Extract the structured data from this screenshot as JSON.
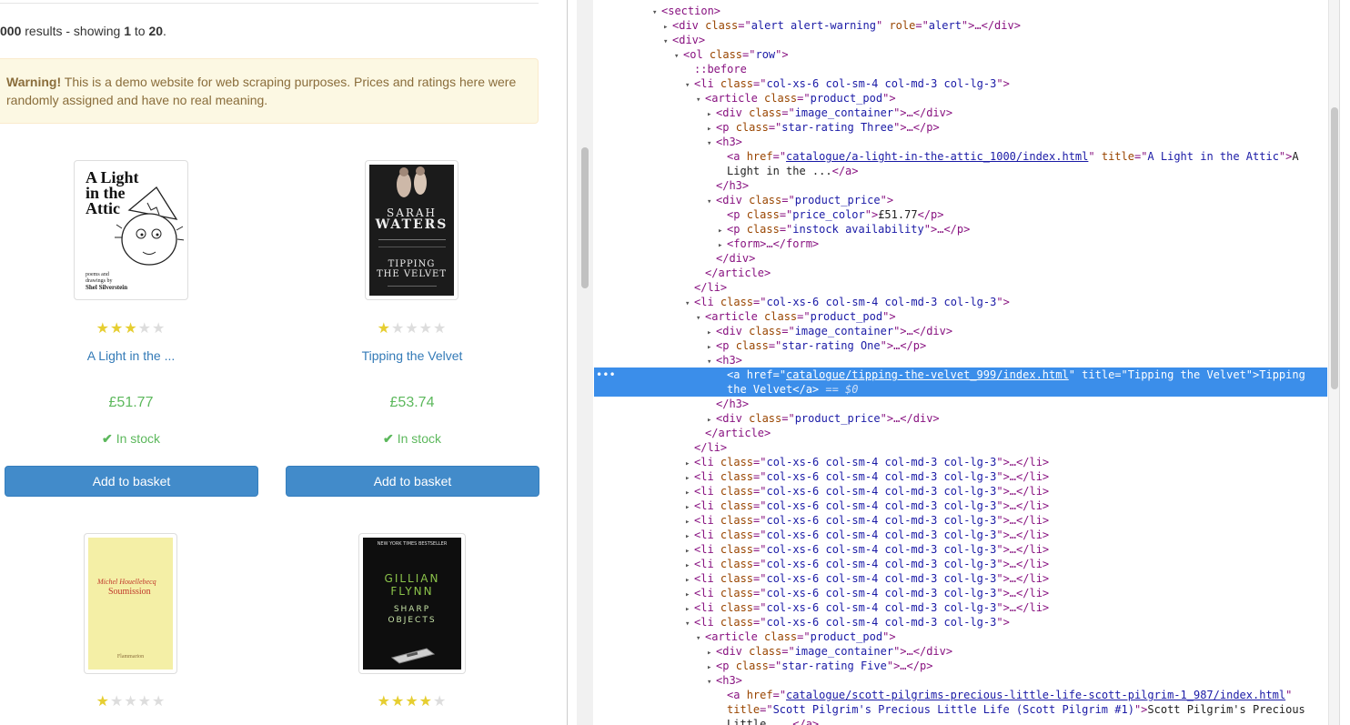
{
  "results": {
    "count": "000",
    "text1": " results - showing ",
    "from": "1",
    "text2": " to ",
    "to": "20",
    "text3": "."
  },
  "alert": {
    "strong": "Warning!",
    "text": " This is a demo website for web scraping purposes. Prices and ratings here were randomly assigned and have no real meaning."
  },
  "products": [
    {
      "title": "A Light in the ...",
      "rating": 3,
      "price": "£51.77",
      "stock": "In stock",
      "button": "Add to basket",
      "cover": {
        "line1": "A Light",
        "line2": "in the",
        "line3": "Attic",
        "byline1": "poems and",
        "byline2": "drawings by",
        "author": "Shel Silverstein"
      }
    },
    {
      "title": "Tipping the Velvet",
      "rating": 1,
      "price": "£53.74",
      "stock": "In stock",
      "button": "Add to basket",
      "cover": {
        "author1": "SARAH",
        "author2": "WATERS",
        "title1": "TIPPING",
        "title2": "THE VELVET"
      }
    },
    {
      "title": "",
      "rating": 1,
      "cover": {
        "author": "Michel Houellebecq",
        "title": "Soumission",
        "publisher": "Flammarion"
      }
    },
    {
      "title": "",
      "rating": 4,
      "cover": {
        "top": "NEW YORK TIMES BESTSELLER",
        "author1": "GILLIAN",
        "author2": "FLYNN",
        "title1": "SHARP",
        "title2": "OBJECTS"
      }
    }
  ],
  "devtools": {
    "selected_suffix": " == $0",
    "lines": [
      {
        "ind": 6,
        "tri": "▾",
        "parts": [
          [
            "t",
            "<section>"
          ]
        ]
      },
      {
        "ind": 7,
        "tri": "▸",
        "parts": [
          [
            "t",
            "<div "
          ],
          [
            "an",
            "class"
          ],
          [
            "t",
            "=\""
          ],
          [
            "av",
            "alert alert-warning"
          ],
          [
            "t",
            "\" "
          ],
          [
            "an",
            "role"
          ],
          [
            "t",
            "=\""
          ],
          [
            "av",
            "alert"
          ],
          [
            "t",
            "\">…</div>"
          ]
        ]
      },
      {
        "ind": 7,
        "tri": "▾",
        "parts": [
          [
            "t",
            "<div>"
          ]
        ]
      },
      {
        "ind": 8,
        "tri": "▾",
        "parts": [
          [
            "t",
            "<ol "
          ],
          [
            "an",
            "class"
          ],
          [
            "t",
            "=\""
          ],
          [
            "av",
            "row"
          ],
          [
            "t",
            "\">"
          ]
        ]
      },
      {
        "ind": 9,
        "tri": "",
        "parts": [
          [
            "ps",
            "::before"
          ]
        ]
      },
      {
        "ind": 9,
        "tri": "▾",
        "parts": [
          [
            "t",
            "<li "
          ],
          [
            "an",
            "class"
          ],
          [
            "t",
            "=\""
          ],
          [
            "av",
            "col-xs-6 col-sm-4 col-md-3 col-lg-3"
          ],
          [
            "t",
            "\">"
          ]
        ]
      },
      {
        "ind": 10,
        "tri": "▾",
        "parts": [
          [
            "t",
            "<article "
          ],
          [
            "an",
            "class"
          ],
          [
            "t",
            "=\""
          ],
          [
            "av",
            "product_pod"
          ],
          [
            "t",
            "\">"
          ]
        ]
      },
      {
        "ind": 11,
        "tri": "▸",
        "parts": [
          [
            "t",
            "<div "
          ],
          [
            "an",
            "class"
          ],
          [
            "t",
            "=\""
          ],
          [
            "av",
            "image_container"
          ],
          [
            "t",
            "\">…</div>"
          ]
        ]
      },
      {
        "ind": 11,
        "tri": "▸",
        "parts": [
          [
            "t",
            "<p "
          ],
          [
            "an",
            "class"
          ],
          [
            "t",
            "=\""
          ],
          [
            "av",
            "star-rating Three"
          ],
          [
            "t",
            "\">…</p>"
          ]
        ]
      },
      {
        "ind": 11,
        "tri": "▾",
        "parts": [
          [
            "t",
            "<h3>"
          ]
        ]
      },
      {
        "ind": 12,
        "tri": "",
        "parts": [
          [
            "t",
            "<a "
          ],
          [
            "an",
            "href"
          ],
          [
            "t",
            "=\""
          ],
          [
            "lk",
            "catalogue/a-light-in-the-attic_1000/index.html"
          ],
          [
            "t",
            "\" "
          ],
          [
            "an",
            "title"
          ],
          [
            "t",
            "=\""
          ],
          [
            "av",
            "A Light in the Attic"
          ],
          [
            "t",
            "\">"
          ],
          [
            "tx",
            "A"
          ]
        ]
      },
      {
        "ind": 12,
        "tri": "",
        "parts": [
          [
            "tx",
            "Light in the ..."
          ],
          [
            "t",
            "</a>"
          ]
        ]
      },
      {
        "ind": 11,
        "tri": "",
        "parts": [
          [
            "t",
            "</h3>"
          ]
        ]
      },
      {
        "ind": 11,
        "tri": "▾",
        "parts": [
          [
            "t",
            "<div "
          ],
          [
            "an",
            "class"
          ],
          [
            "t",
            "=\""
          ],
          [
            "av",
            "product_price"
          ],
          [
            "t",
            "\">"
          ]
        ]
      },
      {
        "ind": 12,
        "tri": "",
        "parts": [
          [
            "t",
            "<p "
          ],
          [
            "an",
            "class"
          ],
          [
            "t",
            "=\""
          ],
          [
            "av",
            "price_color"
          ],
          [
            "t",
            "\">"
          ],
          [
            "tx",
            "£51.77"
          ],
          [
            "t",
            "</p>"
          ]
        ]
      },
      {
        "ind": 12,
        "tri": "▸",
        "parts": [
          [
            "t",
            "<p "
          ],
          [
            "an",
            "class"
          ],
          [
            "t",
            "=\""
          ],
          [
            "av",
            "instock availability"
          ],
          [
            "t",
            "\">…</p>"
          ]
        ]
      },
      {
        "ind": 12,
        "tri": "▸",
        "parts": [
          [
            "t",
            "<form>…</form>"
          ]
        ]
      },
      {
        "ind": 11,
        "tri": "",
        "parts": [
          [
            "t",
            "</div>"
          ]
        ]
      },
      {
        "ind": 10,
        "tri": "",
        "parts": [
          [
            "t",
            "</article>"
          ]
        ]
      },
      {
        "ind": 9,
        "tri": "",
        "parts": [
          [
            "t",
            "</li>"
          ]
        ]
      },
      {
        "ind": 9,
        "tri": "▾",
        "parts": [
          [
            "t",
            "<li "
          ],
          [
            "an",
            "class"
          ],
          [
            "t",
            "=\""
          ],
          [
            "av",
            "col-xs-6 col-sm-4 col-md-3 col-lg-3"
          ],
          [
            "t",
            "\">"
          ]
        ]
      },
      {
        "ind": 10,
        "tri": "▾",
        "parts": [
          [
            "t",
            "<article "
          ],
          [
            "an",
            "class"
          ],
          [
            "t",
            "=\""
          ],
          [
            "av",
            "product_pod"
          ],
          [
            "t",
            "\">"
          ]
        ]
      },
      {
        "ind": 11,
        "tri": "▸",
        "parts": [
          [
            "t",
            "<div "
          ],
          [
            "an",
            "class"
          ],
          [
            "t",
            "=\""
          ],
          [
            "av",
            "image_container"
          ],
          [
            "t",
            "\">…</div>"
          ]
        ]
      },
      {
        "ind": 11,
        "tri": "▸",
        "parts": [
          [
            "t",
            "<p "
          ],
          [
            "an",
            "class"
          ],
          [
            "t",
            "=\""
          ],
          [
            "av",
            "star-rating One"
          ],
          [
            "t",
            "\">…</p>"
          ]
        ]
      },
      {
        "ind": 11,
        "tri": "▾",
        "parts": [
          [
            "t",
            "<h3>"
          ]
        ]
      },
      {
        "ind": 12,
        "tri": "",
        "selected": true,
        "parts": [
          [
            "t",
            "<a "
          ],
          [
            "an",
            "href"
          ],
          [
            "t",
            "=\""
          ],
          [
            "lk",
            "catalogue/tipping-the-velvet_999/index.html"
          ],
          [
            "t",
            "\" "
          ],
          [
            "an",
            "title"
          ],
          [
            "t",
            "=\""
          ],
          [
            "av",
            "Tipping the Velvet"
          ],
          [
            "t",
            "\">"
          ],
          [
            "tx",
            "Tipping"
          ]
        ],
        "cont": [
          [
            "tx",
            "the Velvet"
          ],
          [
            "t",
            "</a>"
          ]
        ]
      },
      {
        "ind": 11,
        "tri": "",
        "parts": [
          [
            "t",
            "</h3>"
          ]
        ]
      },
      {
        "ind": 11,
        "tri": "▸",
        "parts": [
          [
            "t",
            "<div "
          ],
          [
            "an",
            "class"
          ],
          [
            "t",
            "=\""
          ],
          [
            "av",
            "product_price"
          ],
          [
            "t",
            "\">…</div>"
          ]
        ]
      },
      {
        "ind": 10,
        "tri": "",
        "parts": [
          [
            "t",
            "</article>"
          ]
        ]
      },
      {
        "ind": 9,
        "tri": "",
        "parts": [
          [
            "t",
            "</li>"
          ]
        ]
      },
      {
        "ind": 9,
        "tri": "▸",
        "parts": [
          [
            "t",
            "<li "
          ],
          [
            "an",
            "class"
          ],
          [
            "t",
            "=\""
          ],
          [
            "av",
            "col-xs-6 col-sm-4 col-md-3 col-lg-3"
          ],
          [
            "t",
            "\">…</li>"
          ]
        ]
      },
      {
        "ind": 9,
        "tri": "▸",
        "parts": [
          [
            "t",
            "<li "
          ],
          [
            "an",
            "class"
          ],
          [
            "t",
            "=\""
          ],
          [
            "av",
            "col-xs-6 col-sm-4 col-md-3 col-lg-3"
          ],
          [
            "t",
            "\">…</li>"
          ]
        ]
      },
      {
        "ind": 9,
        "tri": "▸",
        "parts": [
          [
            "t",
            "<li "
          ],
          [
            "an",
            "class"
          ],
          [
            "t",
            "=\""
          ],
          [
            "av",
            "col-xs-6 col-sm-4 col-md-3 col-lg-3"
          ],
          [
            "t",
            "\">…</li>"
          ]
        ]
      },
      {
        "ind": 9,
        "tri": "▸",
        "parts": [
          [
            "t",
            "<li "
          ],
          [
            "an",
            "class"
          ],
          [
            "t",
            "=\""
          ],
          [
            "av",
            "col-xs-6 col-sm-4 col-md-3 col-lg-3"
          ],
          [
            "t",
            "\">…</li>"
          ]
        ]
      },
      {
        "ind": 9,
        "tri": "▸",
        "parts": [
          [
            "t",
            "<li "
          ],
          [
            "an",
            "class"
          ],
          [
            "t",
            "=\""
          ],
          [
            "av",
            "col-xs-6 col-sm-4 col-md-3 col-lg-3"
          ],
          [
            "t",
            "\">…</li>"
          ]
        ]
      },
      {
        "ind": 9,
        "tri": "▸",
        "parts": [
          [
            "t",
            "<li "
          ],
          [
            "an",
            "class"
          ],
          [
            "t",
            "=\""
          ],
          [
            "av",
            "col-xs-6 col-sm-4 col-md-3 col-lg-3"
          ],
          [
            "t",
            "\">…</li>"
          ]
        ]
      },
      {
        "ind": 9,
        "tri": "▸",
        "parts": [
          [
            "t",
            "<li "
          ],
          [
            "an",
            "class"
          ],
          [
            "t",
            "=\""
          ],
          [
            "av",
            "col-xs-6 col-sm-4 col-md-3 col-lg-3"
          ],
          [
            "t",
            "\">…</li>"
          ]
        ]
      },
      {
        "ind": 9,
        "tri": "▸",
        "parts": [
          [
            "t",
            "<li "
          ],
          [
            "an",
            "class"
          ],
          [
            "t",
            "=\""
          ],
          [
            "av",
            "col-xs-6 col-sm-4 col-md-3 col-lg-3"
          ],
          [
            "t",
            "\">…</li>"
          ]
        ]
      },
      {
        "ind": 9,
        "tri": "▸",
        "parts": [
          [
            "t",
            "<li "
          ],
          [
            "an",
            "class"
          ],
          [
            "t",
            "=\""
          ],
          [
            "av",
            "col-xs-6 col-sm-4 col-md-3 col-lg-3"
          ],
          [
            "t",
            "\">…</li>"
          ]
        ]
      },
      {
        "ind": 9,
        "tri": "▸",
        "parts": [
          [
            "t",
            "<li "
          ],
          [
            "an",
            "class"
          ],
          [
            "t",
            "=\""
          ],
          [
            "av",
            "col-xs-6 col-sm-4 col-md-3 col-lg-3"
          ],
          [
            "t",
            "\">…</li>"
          ]
        ]
      },
      {
        "ind": 9,
        "tri": "▸",
        "parts": [
          [
            "t",
            "<li "
          ],
          [
            "an",
            "class"
          ],
          [
            "t",
            "=\""
          ],
          [
            "av",
            "col-xs-6 col-sm-4 col-md-3 col-lg-3"
          ],
          [
            "t",
            "\">…</li>"
          ]
        ]
      },
      {
        "ind": 9,
        "tri": "▾",
        "parts": [
          [
            "t",
            "<li "
          ],
          [
            "an",
            "class"
          ],
          [
            "t",
            "=\""
          ],
          [
            "av",
            "col-xs-6 col-sm-4 col-md-3 col-lg-3"
          ],
          [
            "t",
            "\">"
          ]
        ]
      },
      {
        "ind": 10,
        "tri": "▾",
        "parts": [
          [
            "t",
            "<article "
          ],
          [
            "an",
            "class"
          ],
          [
            "t",
            "=\""
          ],
          [
            "av",
            "product_pod"
          ],
          [
            "t",
            "\">"
          ]
        ]
      },
      {
        "ind": 11,
        "tri": "▸",
        "parts": [
          [
            "t",
            "<div "
          ],
          [
            "an",
            "class"
          ],
          [
            "t",
            "=\""
          ],
          [
            "av",
            "image_container"
          ],
          [
            "t",
            "\">…</div>"
          ]
        ]
      },
      {
        "ind": 11,
        "tri": "▸",
        "parts": [
          [
            "t",
            "<p "
          ],
          [
            "an",
            "class"
          ],
          [
            "t",
            "=\""
          ],
          [
            "av",
            "star-rating Five"
          ],
          [
            "t",
            "\">…</p>"
          ]
        ]
      },
      {
        "ind": 11,
        "tri": "▾",
        "parts": [
          [
            "t",
            "<h3>"
          ]
        ]
      },
      {
        "ind": 12,
        "tri": "",
        "parts": [
          [
            "t",
            "<a "
          ],
          [
            "an",
            "href"
          ],
          [
            "t",
            "=\""
          ],
          [
            "lk",
            "catalogue/scott-pilgrims-precious-little-life-scott-pilgrim-1_987/index.html"
          ],
          [
            "t",
            "\""
          ]
        ]
      },
      {
        "ind": 12,
        "tri": "",
        "parts": [
          [
            "an",
            "title"
          ],
          [
            "t",
            "=\""
          ],
          [
            "av",
            "Scott Pilgrim's Precious Little Life (Scott Pilgrim #1)"
          ],
          [
            "t",
            "\">"
          ],
          [
            "tx",
            "Scott Pilgrim's Precious"
          ]
        ]
      },
      {
        "ind": 12,
        "tri": "",
        "parts": [
          [
            "tx",
            "Little ..."
          ],
          [
            "t",
            "</a>"
          ]
        ]
      }
    ]
  }
}
